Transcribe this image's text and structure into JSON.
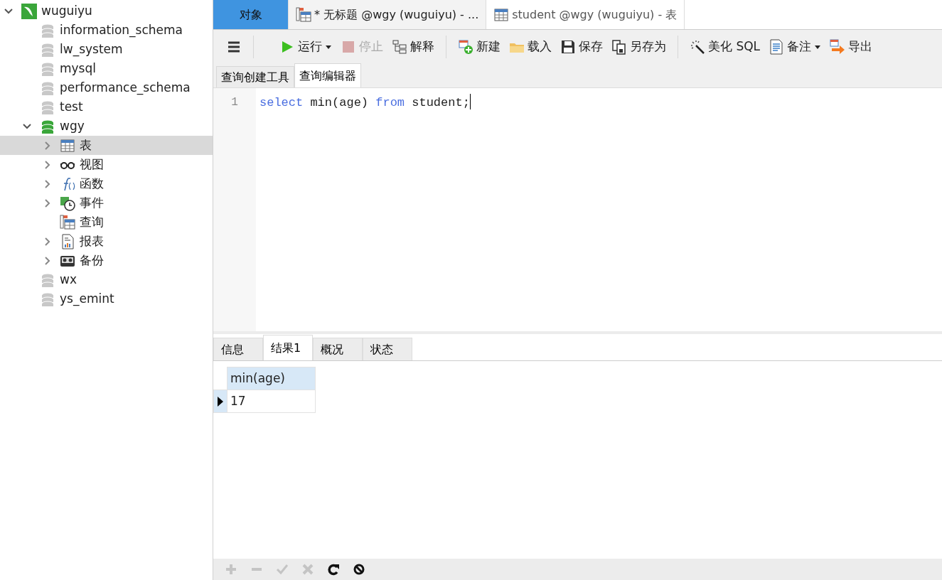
{
  "tree": {
    "label": "wuguiyu",
    "expanded": true,
    "children": [
      {
        "label": "information_schema",
        "open": false
      },
      {
        "label": "lw_system",
        "open": false
      },
      {
        "label": "mysql",
        "open": false
      },
      {
        "label": "performance_schema",
        "open": false
      },
      {
        "label": "test",
        "open": false
      },
      {
        "label": "wgy",
        "open": true,
        "expanded": true,
        "children": [
          {
            "label": "表",
            "kind": "table",
            "expandable": true,
            "selected": true
          },
          {
            "label": "视图",
            "kind": "view",
            "expandable": true,
            "selected": false
          },
          {
            "label": "函数",
            "kind": "function",
            "expandable": true,
            "selected": false
          },
          {
            "label": "事件",
            "kind": "event",
            "expandable": true,
            "selected": false
          },
          {
            "label": "查询",
            "kind": "query",
            "expandable": false,
            "selected": false
          },
          {
            "label": "报表",
            "kind": "report",
            "expandable": true,
            "selected": false
          },
          {
            "label": "备份",
            "kind": "backup",
            "expandable": true,
            "selected": false
          }
        ]
      },
      {
        "label": "wx",
        "open": false
      },
      {
        "label": "ys_emint",
        "open": false
      }
    ]
  },
  "window_tabs": [
    {
      "label": "对象",
      "kind": "objects",
      "selected": false
    },
    {
      "label": "* 无标题 @wgy (wuguiyu) - ...",
      "kind": "query",
      "selected": true
    },
    {
      "label": "student @wgy (wuguiyu) - 表",
      "kind": "table",
      "selected": false
    }
  ],
  "toolbar": [
    {
      "kind": "menu"
    },
    {
      "kind": "separator"
    },
    {
      "kind": "run",
      "label": "运行",
      "dropdown": true,
      "disabled": false
    },
    {
      "kind": "stop",
      "label": "停止",
      "dropdown": false,
      "disabled": true
    },
    {
      "kind": "explain",
      "label": "解释",
      "dropdown": false,
      "disabled": false
    },
    {
      "kind": "separator"
    },
    {
      "kind": "new",
      "label": "新建",
      "dropdown": false,
      "disabled": false
    },
    {
      "kind": "load",
      "label": "载入",
      "dropdown": false,
      "disabled": false
    },
    {
      "kind": "save",
      "label": "保存",
      "dropdown": false,
      "disabled": false
    },
    {
      "kind": "saveas",
      "label": "另存为",
      "dropdown": false,
      "disabled": false
    },
    {
      "kind": "separator"
    },
    {
      "kind": "beautify",
      "label": "美化 SQL",
      "dropdown": false,
      "disabled": false
    },
    {
      "kind": "comment",
      "label": "备注",
      "dropdown": true,
      "disabled": false
    },
    {
      "kind": "export",
      "label": "导出",
      "dropdown": false,
      "disabled": false
    }
  ],
  "editor_tabs": [
    {
      "label": "查询创建工具",
      "selected": false
    },
    {
      "label": "查询编辑器",
      "selected": true
    }
  ],
  "editor": {
    "lines": [
      {
        "number": "1",
        "cursor": true,
        "tokens": [
          {
            "text": "select",
            "kind": "keyword"
          },
          {
            "text": " min(age) ",
            "kind": "plain"
          },
          {
            "text": "from",
            "kind": "keyword"
          },
          {
            "text": " student;",
            "kind": "plain"
          }
        ]
      }
    ]
  },
  "result_tabs": [
    {
      "label": "信息",
      "selected": false
    },
    {
      "label": "结果1",
      "selected": true
    },
    {
      "label": "概况",
      "selected": false
    },
    {
      "label": "状态",
      "selected": false
    }
  ],
  "result_grid": {
    "columns": [
      "min(age)"
    ],
    "rows": [
      {
        "current": true,
        "cells": [
          "17"
        ]
      }
    ]
  },
  "grid_toolbar": [
    {
      "kind": "add",
      "disabled": true
    },
    {
      "kind": "delete",
      "disabled": true
    },
    {
      "kind": "apply",
      "disabled": true
    },
    {
      "kind": "discard",
      "disabled": true
    },
    {
      "kind": "refresh",
      "disabled": false
    },
    {
      "kind": "stop",
      "disabled": false
    }
  ]
}
